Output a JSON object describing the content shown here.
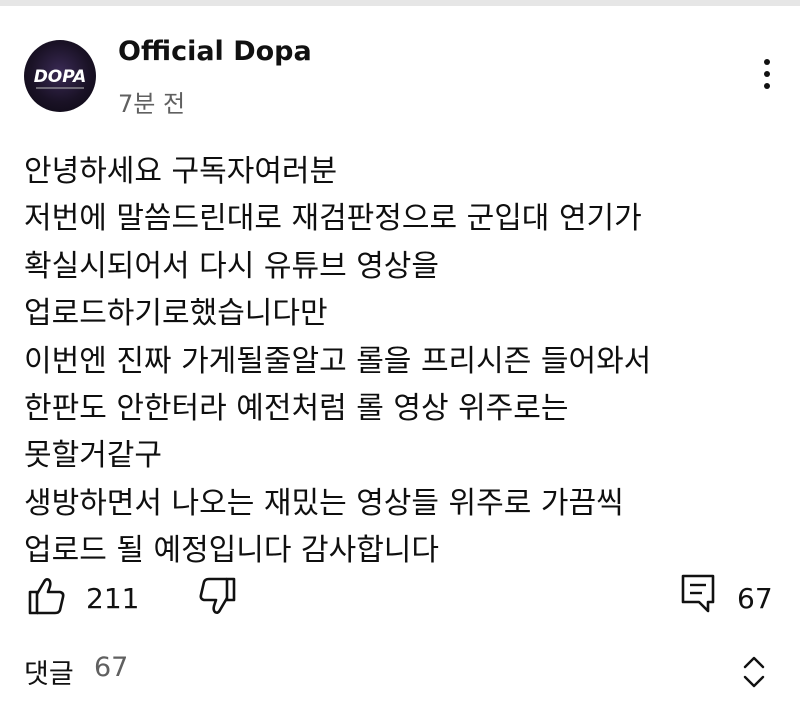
{
  "comment": {
    "channel_name": "Official Dopa",
    "avatar_text": "DOPA",
    "time": "7분 전",
    "lines": [
      "안녕하세요 구독자여러분",
      "저번에 말씀드린대로 재검판정으로 군입대 연기가",
      "확실시되어서 다시 유튜브 영상을",
      "업로드하기로했습니다만",
      "이번엔 진짜 가게될줄알고 롤을 프리시즌 들어와서",
      "한판도 안한터라 예전처럼 롤 영상 위주로는",
      "못할거같구",
      "생방하면서 나오는 재밌는 영상들 위주로 가끔씩",
      "업로드 될 예정입니다 감사합니다"
    ],
    "likes": "211",
    "replies": "67"
  },
  "comments_section": {
    "label": "댓글",
    "count": "67"
  },
  "icons": {
    "more": "more-vertical-icon",
    "like": "thumbs-up-icon",
    "dislike": "thumbs-down-icon",
    "reply": "reply-icon",
    "expand": "expand-icon"
  },
  "colors": {
    "text": "#0f0f0f",
    "secondary": "#606060",
    "avatar_bg": "#1a1226",
    "avatar_text": "#ffffff"
  }
}
